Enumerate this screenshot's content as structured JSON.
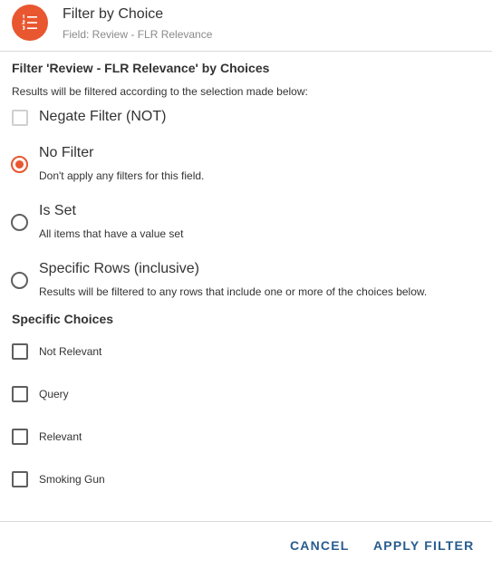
{
  "header": {
    "title": "Filter by Choice",
    "subtitle": "Field: Review - FLR Relevance",
    "icon": "list-icon",
    "accent_color": "#e8572f"
  },
  "filter_section": {
    "title": "Filter 'Review - FLR Relevance' by Choices",
    "description": "Results will be filtered according to the selection made below:"
  },
  "negate": {
    "label": "Negate Filter (NOT)",
    "checked": false
  },
  "options": [
    {
      "label": "No Filter",
      "description": "Don't apply any filters for this field.",
      "selected": true
    },
    {
      "label": "Is Set",
      "description": "All items that have a value set",
      "selected": false
    },
    {
      "label": "Specific Rows (inclusive)",
      "description": "Results will be filtered to any rows that include one or more of the choices below.",
      "selected": false
    }
  ],
  "choices_section": {
    "title": "Specific Choices",
    "items": [
      {
        "label": "Not Relevant",
        "checked": false
      },
      {
        "label": "Query",
        "checked": false
      },
      {
        "label": "Relevant",
        "checked": false
      },
      {
        "label": "Smoking Gun",
        "checked": false
      }
    ]
  },
  "footer": {
    "cancel_label": "CANCEL",
    "apply_label": "APPLY FILTER",
    "button_color": "#285c8f"
  }
}
